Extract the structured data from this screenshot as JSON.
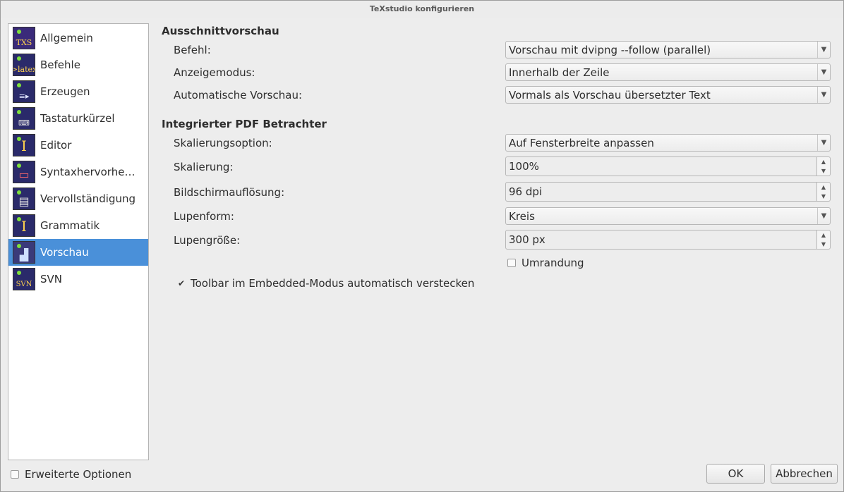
{
  "window": {
    "title": "TeXstudio konfigurieren"
  },
  "sidebar": {
    "items": [
      {
        "label": "Allgemein",
        "icon": "txs-icon",
        "glyph": "TXS",
        "selected": false
      },
      {
        "label": "Befehle",
        "icon": "latex-icon",
        "glyph": ">latex",
        "selected": false
      },
      {
        "label": "Erzeugen",
        "icon": "build-icon",
        "glyph": "≡▸",
        "selected": false
      },
      {
        "label": "Tastaturkürzel",
        "icon": "keyboard-icon",
        "glyph": "⌨",
        "selected": false
      },
      {
        "label": "Editor",
        "icon": "text-cursor-icon",
        "glyph": "I",
        "selected": false
      },
      {
        "label": "Syntaxhervorhebung",
        "icon": "syntax-icon",
        "glyph": "▭",
        "selected": false
      },
      {
        "label": "Vervollständigung",
        "icon": "completion-icon",
        "glyph": "▤",
        "selected": false
      },
      {
        "label": "Grammatik",
        "icon": "grammar-icon",
        "glyph": "I",
        "selected": false
      },
      {
        "label": "Vorschau",
        "icon": "preview-icon",
        "glyph": "▟",
        "selected": true
      },
      {
        "label": "SVN",
        "icon": "svn-icon",
        "glyph": "SVN",
        "selected": false
      }
    ]
  },
  "sections": {
    "snippet": {
      "title": "Ausschnittvorschau",
      "befehl_label": "Befehl:",
      "befehl_value": "Vorschau mit dvipng --follow (parallel)",
      "anzeige_label": "Anzeigemodus:",
      "anzeige_value": "Innerhalb der Zeile",
      "auto_label": "Automatische Vorschau:",
      "auto_value": "Vormals als Vorschau übersetzter Text"
    },
    "pdf": {
      "title": "Integrierter PDF Betrachter",
      "skalopt_label": "Skalierungsoption:",
      "skalopt_value": "Auf Fensterbreite anpassen",
      "skal_label": "Skalierung:",
      "skal_value": "100%",
      "dpi_label": "Bildschirmauflösung:",
      "dpi_value": "96 dpi",
      "lupenform_label": "Lupenform:",
      "lupenform_value": "Kreis",
      "lupengroesse_label": "Lupengröße:",
      "lupengroesse_value": "300 px",
      "umrandung_label": "Umrandung",
      "umrandung_checked": false,
      "toolbar_label": "Toolbar im Embedded-Modus automatisch verstecken",
      "toolbar_checked": true
    }
  },
  "footer": {
    "advanced_label": "Erweiterte Optionen",
    "advanced_checked": false,
    "ok_label": "OK",
    "cancel_label": "Abbrechen"
  }
}
